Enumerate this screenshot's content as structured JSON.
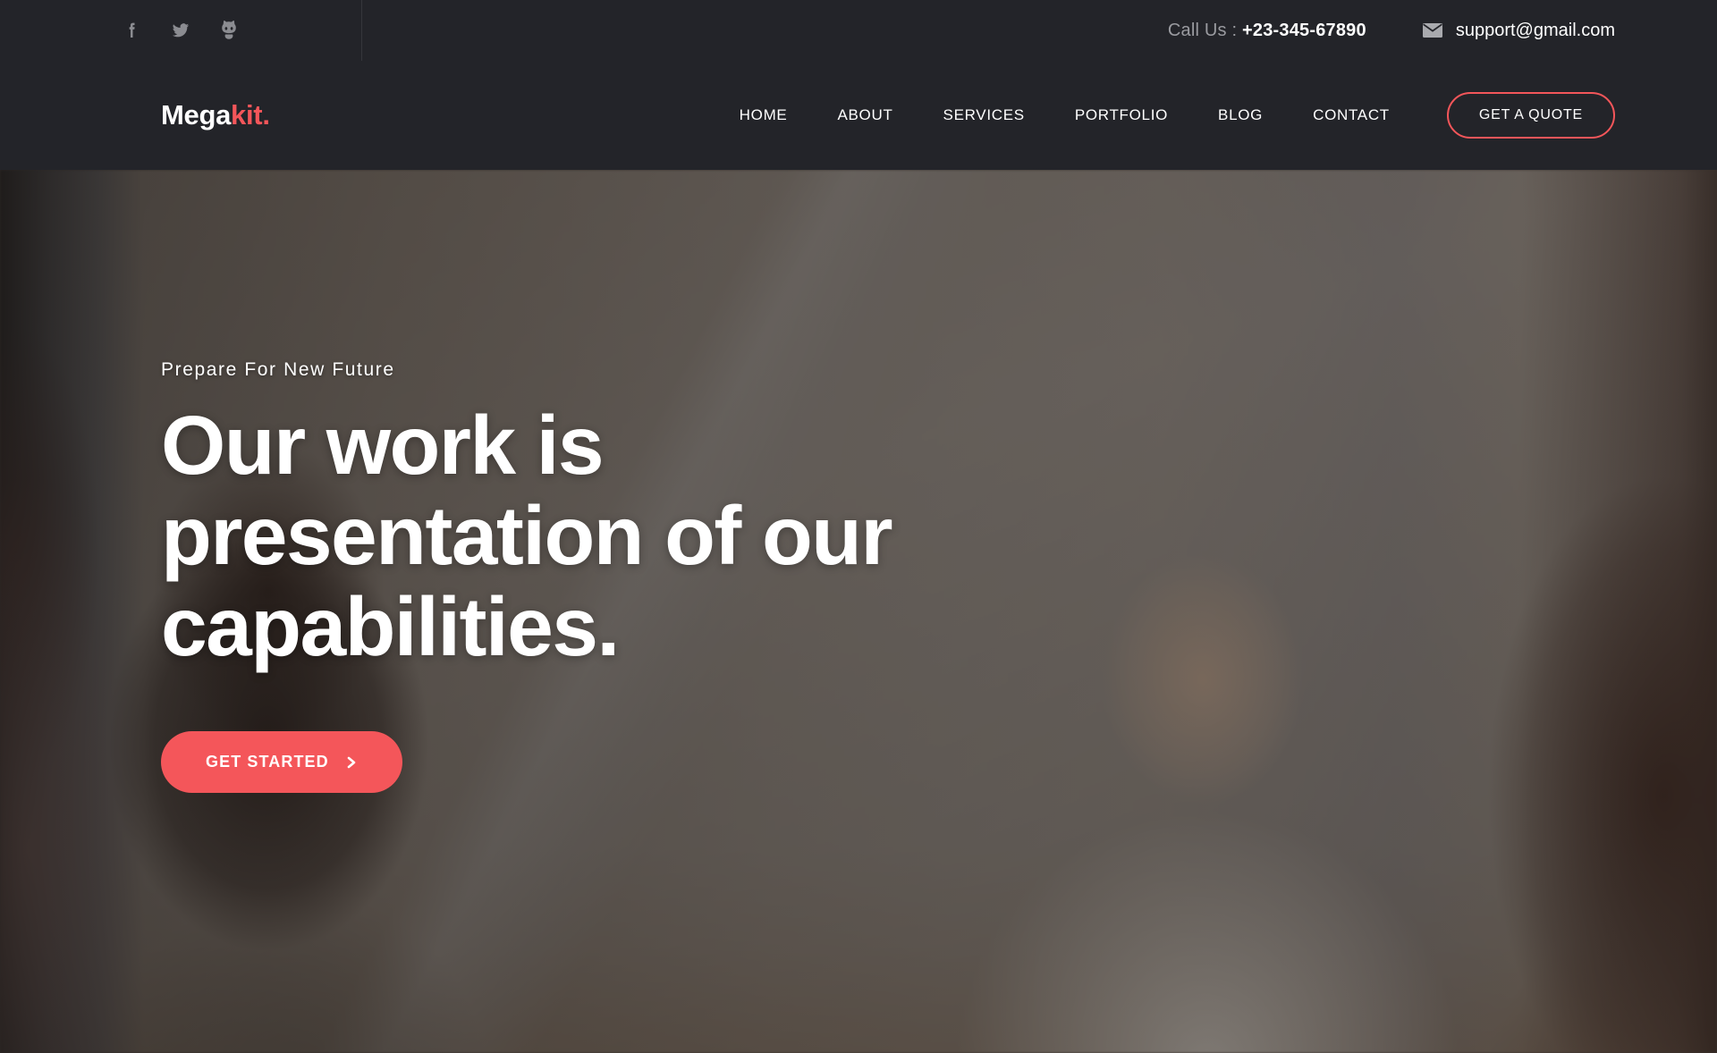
{
  "topbar": {
    "social": [
      {
        "name": "facebook-icon",
        "label": "Facebook"
      },
      {
        "name": "twitter-icon",
        "label": "Twitter"
      },
      {
        "name": "github-icon",
        "label": "GitHub"
      }
    ],
    "call_label": "Call Us : ",
    "phone": "+23-345-67890",
    "email_icon": "envelope-icon",
    "email": "support@gmail.com"
  },
  "header": {
    "logo_primary": "Mega",
    "logo_accent": "kit.",
    "nav": [
      {
        "label": "HOME"
      },
      {
        "label": "ABOUT"
      },
      {
        "label": "SERVICES"
      },
      {
        "label": "PORTFOLIO"
      },
      {
        "label": "BLOG"
      },
      {
        "label": "CONTACT"
      }
    ],
    "quote_label": "GET A QUOTE"
  },
  "hero": {
    "eyebrow": "Prepare For New Future",
    "title_line1": "Our work is",
    "title_line2": "presentation of our",
    "title_line3": "capabilities.",
    "cta_label": "GET STARTED",
    "cta_icon": "chevron-right-icon"
  },
  "colors": {
    "accent": "#f4565a",
    "dark_bar": "#232429",
    "text_white": "#ffffff",
    "muted_text": "#9a9ba0"
  }
}
